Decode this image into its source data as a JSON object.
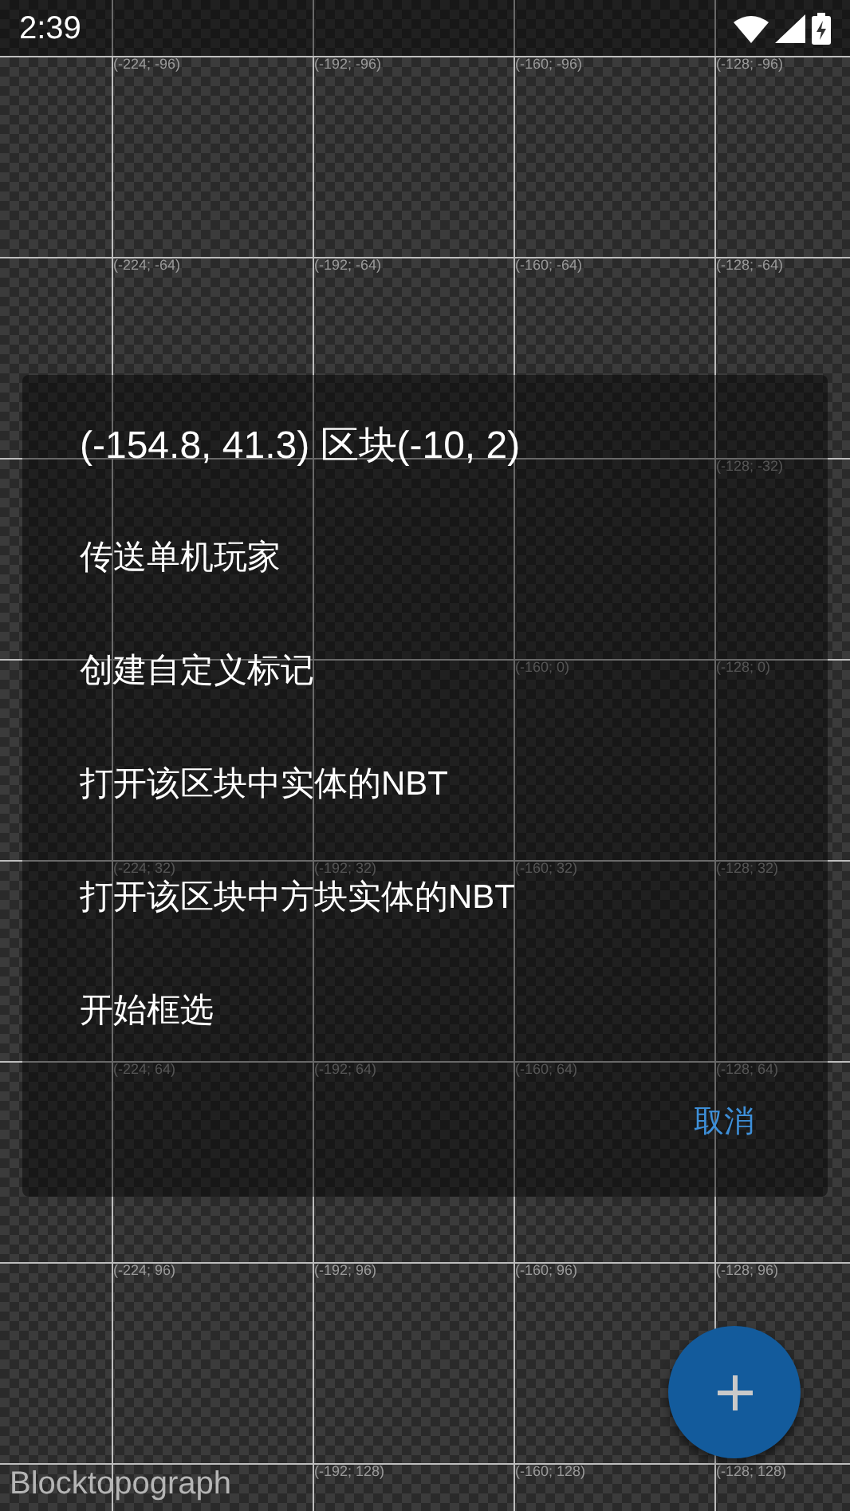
{
  "status_bar": {
    "time": "2:39"
  },
  "map": {
    "rows": [
      [
        "(-224; -96)",
        "(-192; -96)",
        "(-160; -96)",
        "(-128; -96)"
      ],
      [
        "(-224; -64)",
        "(-192; -64)",
        "(-160; -64)",
        "(-128; -64)"
      ],
      [
        null,
        null,
        null,
        "(-128; -32)"
      ],
      [
        null,
        null,
        "(-160; 0)",
        "(-128; 0)"
      ],
      [
        "(-224; 32)",
        "(-192; 32)",
        "(-160; 32)",
        "(-128; 32)"
      ],
      [
        "(-224; 64)",
        "(-192; 64)",
        "(-160; 64)",
        "(-128; 64)"
      ],
      [
        "(-224; 96)",
        "(-192; 96)",
        "(-160; 96)",
        "(-128; 96)"
      ],
      [
        null,
        "(-192; 128)",
        "(-160; 128)",
        "(-128; 128)"
      ]
    ]
  },
  "dialog": {
    "title": "(-154.8, 41.3) 区块(-10, 2)",
    "items": [
      "传送单机玩家",
      "创建自定义标记",
      "打开该区块中实体的NBT",
      "打开该区块中方块实体的NBT",
      "开始框选"
    ],
    "buttons": [
      "取消"
    ]
  },
  "app_name": "Blocktopograph"
}
